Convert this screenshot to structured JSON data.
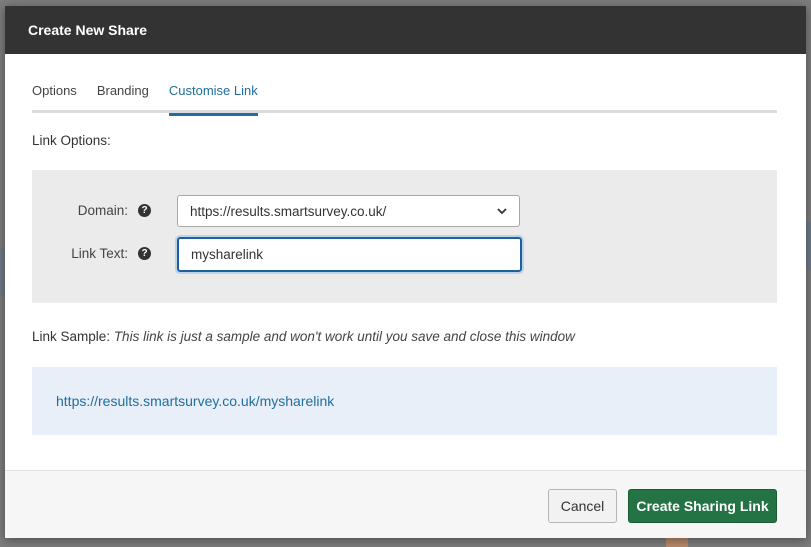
{
  "dialog": {
    "title": "Create New Share"
  },
  "tabs": [
    {
      "label": "Options",
      "active": false
    },
    {
      "label": "Branding",
      "active": false
    },
    {
      "label": "Customise Link",
      "active": true
    }
  ],
  "link_options": {
    "heading": "Link Options:",
    "domain": {
      "label": "Domain:",
      "help_icon": "question-circle-icon",
      "selected_value": "https://results.smartsurvey.co.uk/",
      "dropdown_icon": "chevron-down-icon"
    },
    "link_text": {
      "label": "Link Text:",
      "help_icon": "question-circle-icon",
      "value": "mysharelink"
    }
  },
  "link_sample": {
    "label": "Link Sample:",
    "note": "This link is just a sample and won't work until you save and close this window",
    "url": "https://results.smartsurvey.co.uk/mysharelink"
  },
  "footer": {
    "cancel_label": "Cancel",
    "create_label": "Create Sharing Link"
  },
  "colors": {
    "header_bg": "#333333",
    "accent_blue": "#1f6e9e",
    "primary_green": "#237344",
    "panel_gray": "#ebebeb",
    "link_panel_bg": "#e8eff8"
  }
}
